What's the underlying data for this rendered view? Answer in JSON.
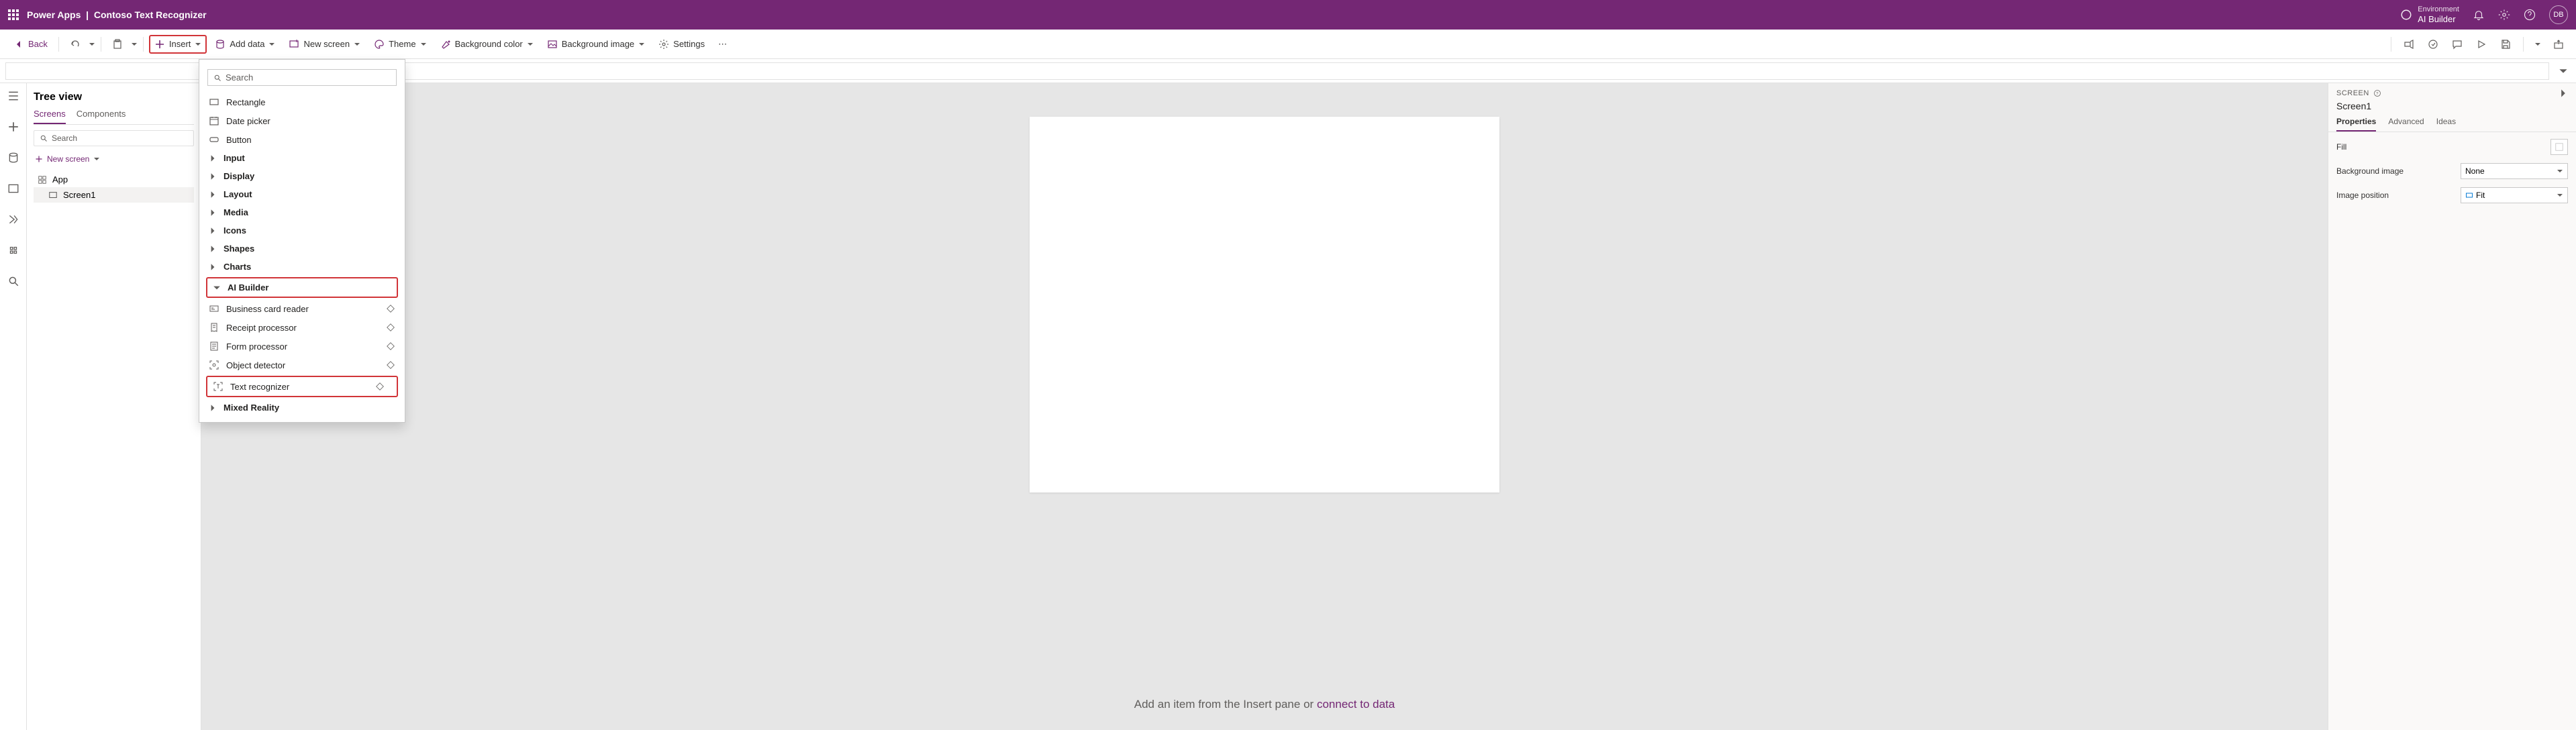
{
  "header": {
    "product": "Power Apps",
    "separator": "|",
    "app_name": "Contoso Text Recognizer",
    "env_label": "Environment",
    "env_name": "AI Builder",
    "avatar_initials": "DB"
  },
  "cmdbar": {
    "back": "Back",
    "insert": "Insert",
    "add_data": "Add data",
    "new_screen": "New screen",
    "theme": "Theme",
    "bg_color": "Background color",
    "bg_image": "Background image",
    "settings": "Settings"
  },
  "tree": {
    "title": "Tree view",
    "tabs": {
      "screens": "Screens",
      "components": "Components"
    },
    "search_placeholder": "Search",
    "new_screen": "New screen",
    "items": [
      {
        "label": "App"
      },
      {
        "label": "Screen1"
      }
    ]
  },
  "insert_dropdown": {
    "search_placeholder": "Search",
    "simple": [
      {
        "label": "Rectangle"
      },
      {
        "label": "Date picker"
      },
      {
        "label": "Button"
      }
    ],
    "categories": [
      {
        "label": "Input"
      },
      {
        "label": "Display"
      },
      {
        "label": "Layout"
      },
      {
        "label": "Media"
      },
      {
        "label": "Icons"
      },
      {
        "label": "Shapes"
      },
      {
        "label": "Charts"
      }
    ],
    "ai_builder": {
      "label": "AI Builder",
      "items": [
        {
          "label": "Business card reader"
        },
        {
          "label": "Receipt processor"
        },
        {
          "label": "Form processor"
        },
        {
          "label": "Object detector"
        },
        {
          "label": "Text recognizer"
        }
      ]
    },
    "mixed_reality": {
      "label": "Mixed Reality"
    }
  },
  "canvas": {
    "hint_pre": "Add an item from the Insert pane",
    "hint_or": "or",
    "hint_link": "connect to data"
  },
  "props": {
    "header": "SCREEN",
    "screen_name": "Screen1",
    "tabs": {
      "properties": "Properties",
      "advanced": "Advanced",
      "ideas": "Ideas"
    },
    "fields": {
      "fill": {
        "label": "Fill"
      },
      "bg_image": {
        "label": "Background image",
        "value": "None"
      },
      "img_pos": {
        "label": "Image position",
        "value": "Fit"
      }
    }
  }
}
